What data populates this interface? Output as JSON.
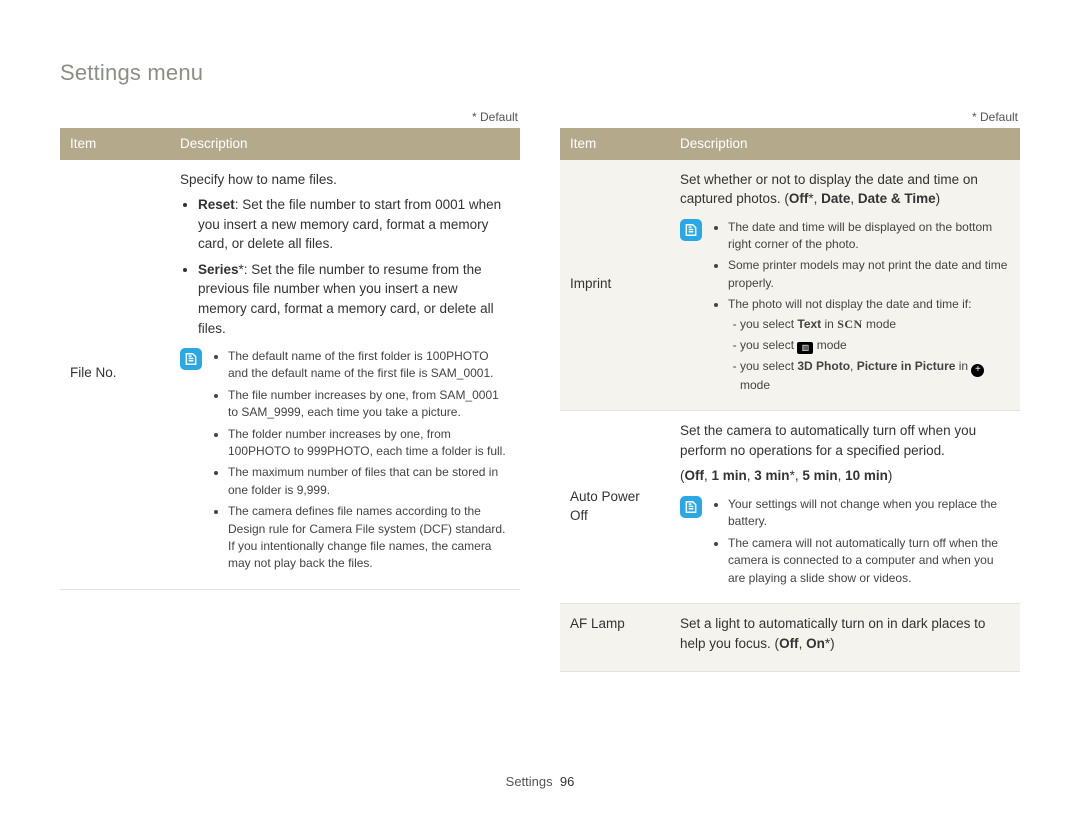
{
  "page_title": "Settings menu",
  "default_note": "* Default",
  "headers": {
    "item": "Item",
    "description": "Description"
  },
  "footer": {
    "section": "Settings",
    "page": "96"
  },
  "left": {
    "row1": {
      "item": "File No.",
      "intro": "Specify how to name files.",
      "b1_label": "Reset",
      "b1_text": ": Set the file number to start from 0001 when you insert a new memory card, format a memory card, or delete all files.",
      "b2_label": "Series",
      "b2_text": "*: Set the file number to resume from the previous file number when you insert a new memory card, format a memory card, or delete all files.",
      "note": {
        "n1": "The default name of the first folder is 100PHOTO and the default name of the first file is SAM_0001.",
        "n2": "The file number increases by one, from SAM_0001 to SAM_9999, each time you take a picture.",
        "n3": "The folder number increases by one, from 100PHOTO to 999PHOTO, each time a folder is full.",
        "n4": "The maximum number of files that can be stored in one folder is 9,999.",
        "n5": "The camera defines file names according to the Design rule for Camera File system (DCF) standard. If you intentionally change file names, the camera may not play back the files."
      }
    }
  },
  "right": {
    "row1": {
      "item": "Imprint",
      "intro_a": "Set whether or not to display the date and time on captured photos. (",
      "intro_off": "Off",
      "intro_b": "*, ",
      "intro_date": "Date",
      "intro_c": ", ",
      "intro_dt": "Date & Time",
      "intro_d": ")",
      "note": {
        "n1": "The date and time will be displayed on the bottom right corner of the photo.",
        "n2": "Some printer models may not print the date and time properly.",
        "n3": "The photo will not display the date and time if:",
        "s1a": "you select ",
        "s1b": "Text",
        "s1c": " in ",
        "s1d": " mode",
        "s2a": "you select ",
        "s2b": " mode",
        "s3a": "you select ",
        "s3b": "3D Photo",
        "s3c": ", ",
        "s3d": "Picture in Picture",
        "s3e": " in ",
        "s3f": " mode"
      }
    },
    "row2": {
      "item": "Auto Power Off",
      "intro": "Set the camera to automatically turn off when you perform no operations for a specified period.",
      "opts_a": "Off",
      "opts_b": "1 min",
      "opts_c": "3 min",
      "opts_d": "5 min",
      "opts_e": "10 min",
      "note": {
        "n1": "Your settings will not change when you replace the battery.",
        "n2": "The camera will not automatically turn off when the camera is connected to a computer and when you are playing a slide show or videos."
      }
    },
    "row3": {
      "item": "AF Lamp",
      "text_a": "Set a light to automatically turn on in dark places to help you focus. (",
      "text_off": "Off",
      "text_b": ", ",
      "text_on": "On",
      "text_c": "*)"
    }
  }
}
